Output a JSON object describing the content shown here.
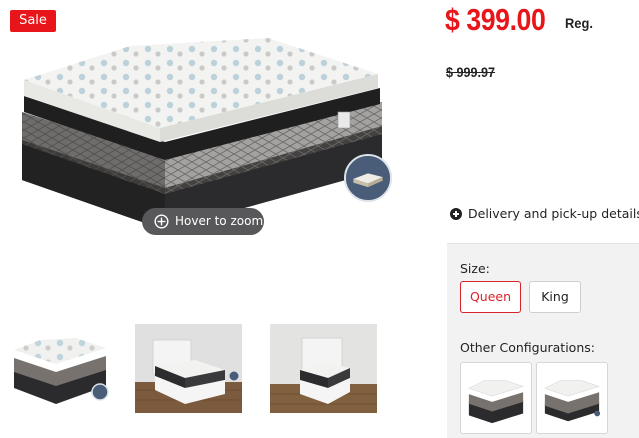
{
  "badge": {
    "label": "Sale"
  },
  "product_image": {
    "zoom_hint": "Hover to zoom"
  },
  "pricing": {
    "price": "$ 399.00",
    "price_label": "Reg.",
    "old_price": "$ 999.97"
  },
  "delivery": {
    "label": "Delivery and pick-up details"
  },
  "size": {
    "label": "Size:",
    "options": [
      "Queen",
      "King"
    ],
    "selected": "Queen"
  },
  "other_configurations": {
    "label": "Other Configurations:"
  },
  "colors": {
    "sale_red": "#e8161b",
    "selected_border": "#d8232a",
    "panel_bg": "#f2f2f2",
    "zoom_pill_bg": "#58585a"
  },
  "icons": [
    "zoom-icon",
    "plus-circle-icon"
  ]
}
